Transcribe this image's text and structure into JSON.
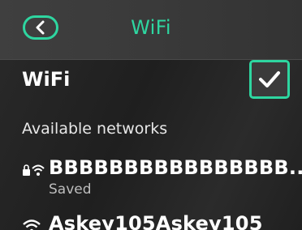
{
  "header": {
    "title": "WiFi",
    "back_icon": "chevron-left-icon"
  },
  "wifi_toggle": {
    "label": "WiFi",
    "checked": true,
    "check_icon": "checkmark-icon"
  },
  "networks_section": {
    "heading": "Available networks",
    "items": [
      {
        "ssid": "BBBBBBBBBBBBBBBB...",
        "status": "Saved",
        "secured": true,
        "icon": "wifi-lock-icon"
      },
      {
        "ssid": "Askey105Askey105",
        "status": "",
        "secured": false,
        "icon": "wifi-icon"
      }
    ]
  },
  "colors": {
    "accent": "#2ed6a0",
    "background": "#262626",
    "header_bg": "#3b3b3b",
    "text": "#ffffff",
    "secondary_text": "#bdbdbd"
  }
}
